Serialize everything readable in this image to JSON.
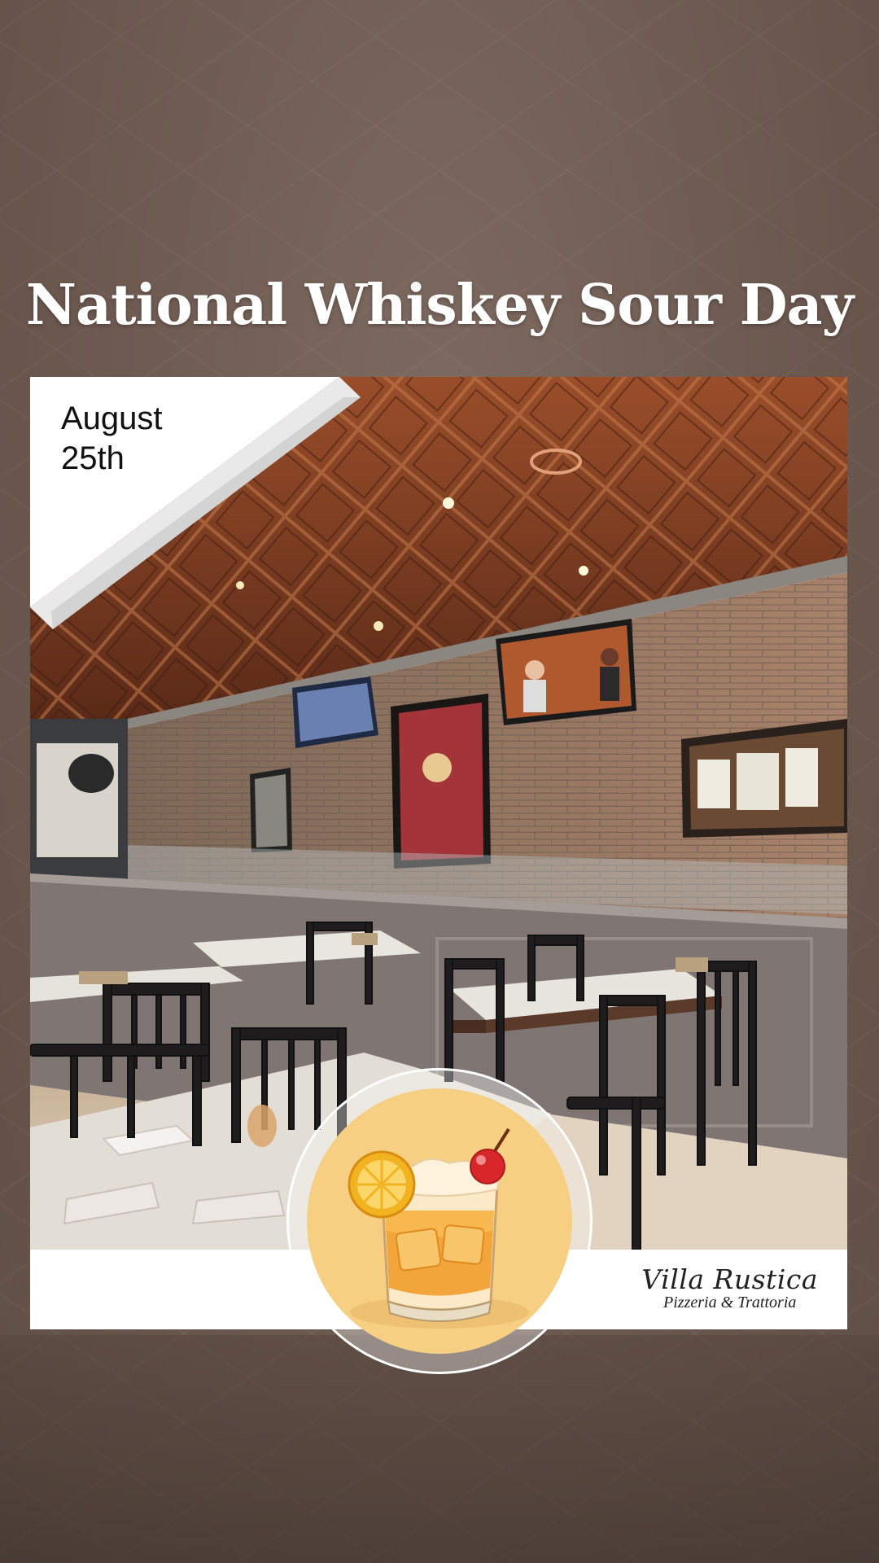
{
  "title": "National Whiskey Sour Day",
  "date": {
    "line1": "August",
    "line2": "25th"
  },
  "brand": {
    "name": "Villa Rustica",
    "tagline": "Pizzeria & Trattoria"
  },
  "icons": {
    "badge": "whiskey-sour-glass-icon"
  },
  "colors": {
    "background": "#6e5a50",
    "ceiling": "#8a4a2a",
    "brick": "#9b7a62",
    "badge": "#f6cf83"
  }
}
